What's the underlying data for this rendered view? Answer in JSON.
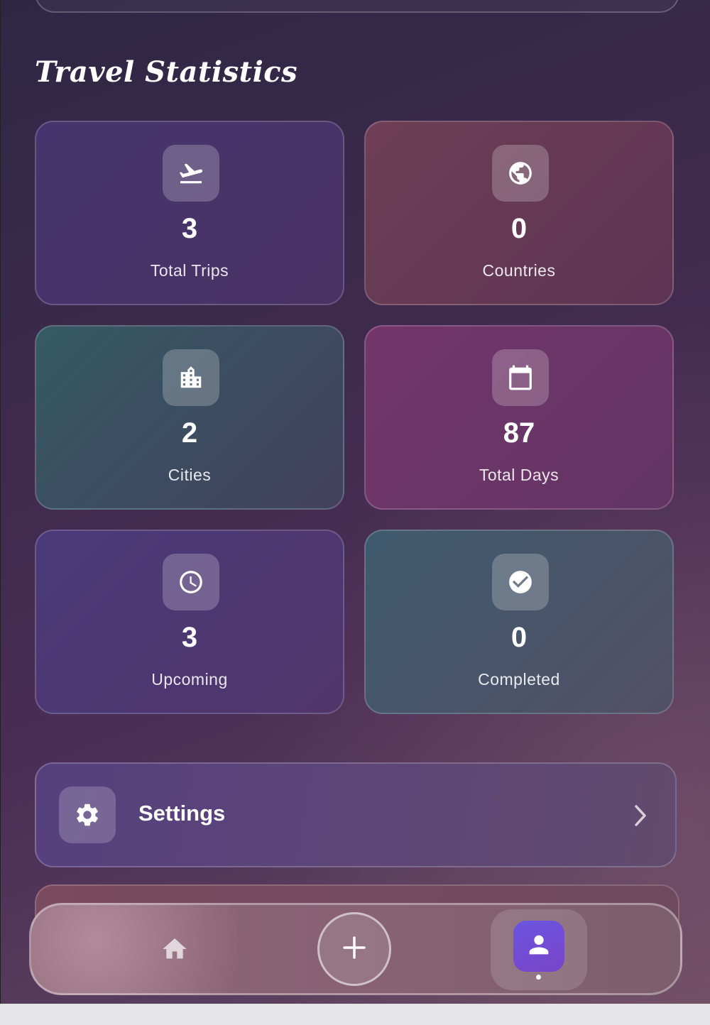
{
  "section_title": "Travel Statistics",
  "stats": [
    {
      "value": "3",
      "label": "Total Trips",
      "icon": "flight-takeoff-icon"
    },
    {
      "value": "0",
      "label": "Countries",
      "icon": "globe-icon"
    },
    {
      "value": "2",
      "label": "Cities",
      "icon": "city-icon"
    },
    {
      "value": "87",
      "label": "Total Days",
      "icon": "calendar-icon"
    },
    {
      "value": "3",
      "label": "Upcoming",
      "icon": "clock-icon"
    },
    {
      "value": "0",
      "label": "Completed",
      "icon": "check-circle-icon"
    }
  ],
  "settings": {
    "label": "Settings",
    "icon": "gear-icon"
  },
  "bottom_nav": {
    "items": [
      {
        "name": "home",
        "icon": "home-icon"
      },
      {
        "name": "add",
        "icon": "plus-icon"
      },
      {
        "name": "profile",
        "icon": "person-icon",
        "active": true
      }
    ]
  },
  "colors": {
    "accent": "#6a55e0",
    "background": "#3e2a4d"
  }
}
